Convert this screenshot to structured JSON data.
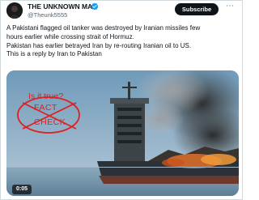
{
  "author": {
    "display_name": "THE UNKNOWN MAN",
    "handle": "@Theunk5555",
    "verified_color": "#1d9bf0"
  },
  "actions": {
    "subscribe_label": "Subscribe",
    "more_label": "⋯"
  },
  "tweet": {
    "lines": [
      "A Pakistani flagged oil tanker was destroyed by Iranian missiles few",
      "hours earlier while crossing strait of Hormuz.",
      "Pakistan has earlier betrayed Iran by re-routing Iranian oil to US.",
      "This is a reply by Iran to Pakistan"
    ]
  },
  "media": {
    "overlay": {
      "question": "Is it true?",
      "fact": "FACT",
      "check": "CHECK",
      "color": "#e02020"
    },
    "video_timer": "0:05"
  }
}
